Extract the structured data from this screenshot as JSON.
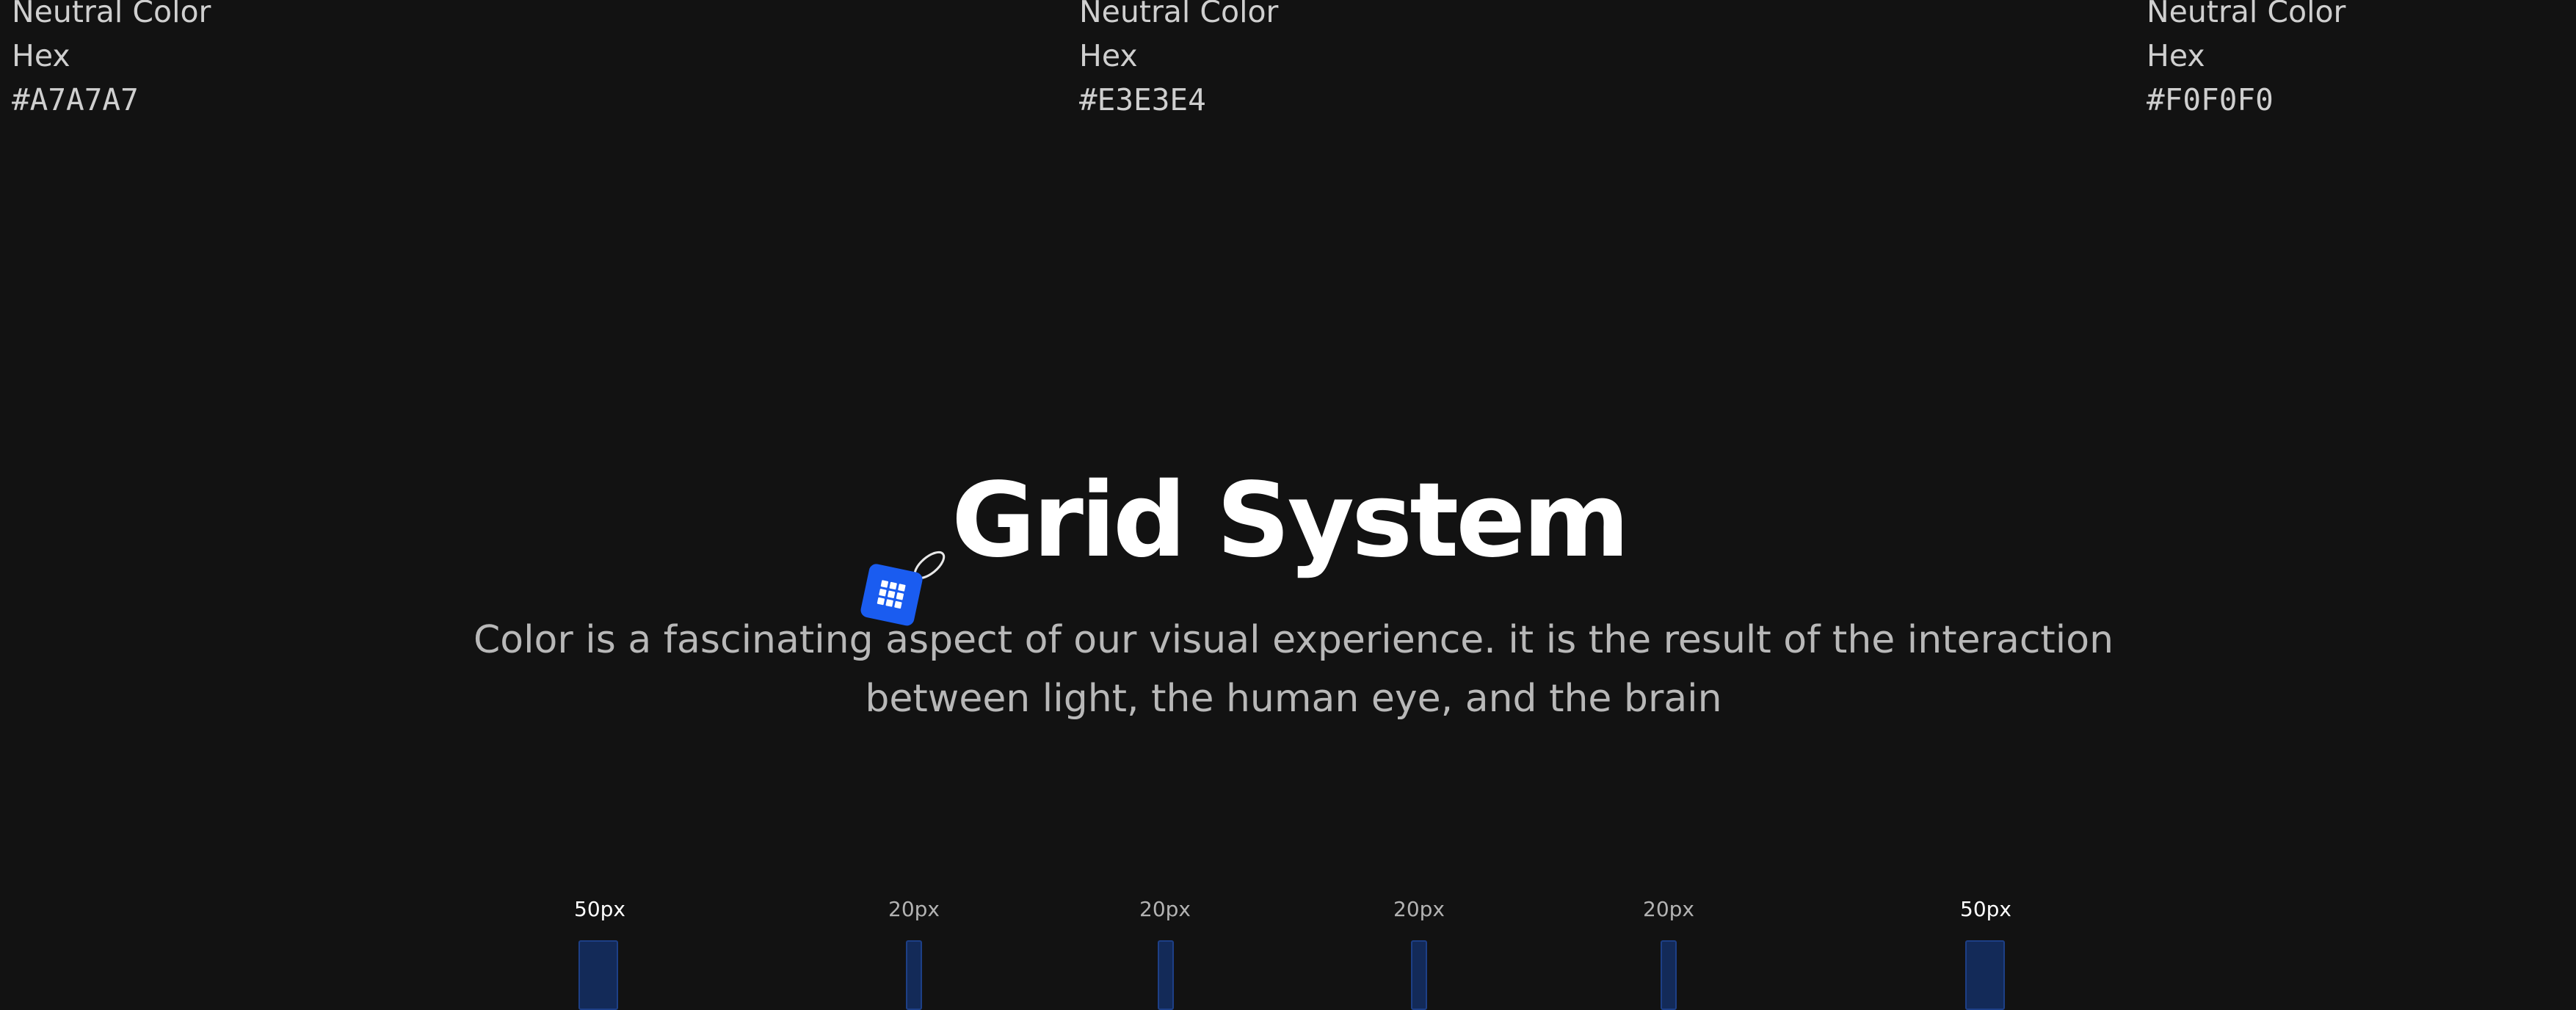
{
  "swatches": [
    {
      "label": "Neutral Color",
      "hex_label": "Hex",
      "hex": "#A7A7A7"
    },
    {
      "label": "Neutral Color",
      "hex_label": "Hex",
      "hex": "#E3E3E4"
    },
    {
      "label": "Neutral Color",
      "hex_label": "Hex",
      "hex": "#F0F0F0"
    }
  ],
  "section": {
    "title": "Grid System",
    "icon": "grid-tag-icon",
    "description": "Color is a fascinating aspect of our visual experience. it is the result of the interaction between light, the human eye, and the brain"
  },
  "grid_spacing": {
    "labels": [
      "50px",
      "20px",
      "20px",
      "20px",
      "20px",
      "50px"
    ],
    "accent_color": "#1b3a7a"
  }
}
